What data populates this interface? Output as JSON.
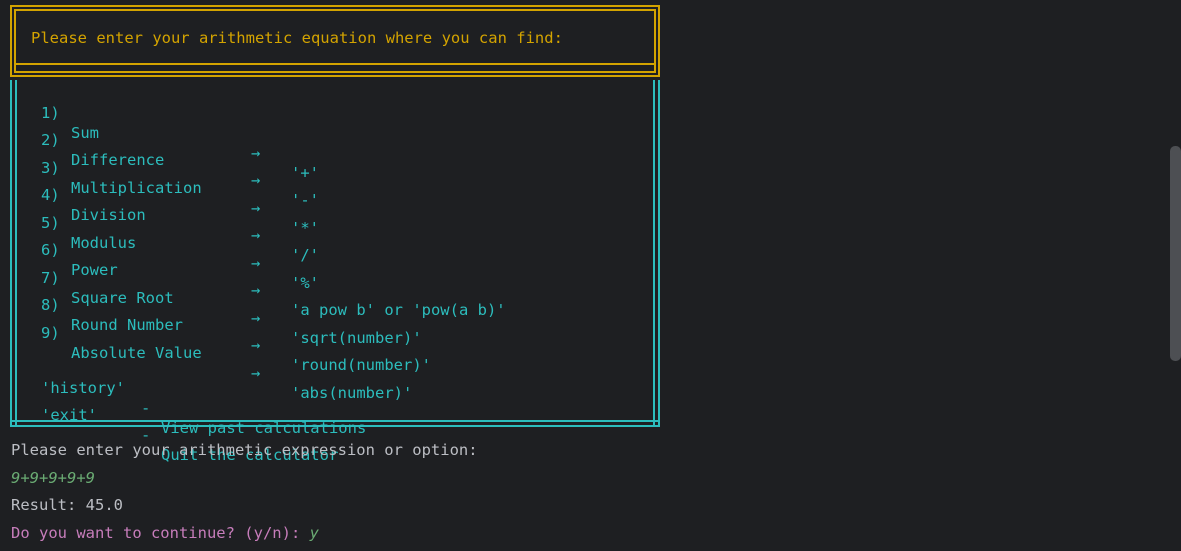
{
  "menu": {
    "header_title": "Please enter your arithmetic equation where you can find:",
    "operations": [
      {
        "num": "1)",
        "name": "Sum",
        "arrow": "→",
        "op": "'+'"
      },
      {
        "num": "2)",
        "name": "Difference",
        "arrow": "→",
        "op": "'-'"
      },
      {
        "num": "3)",
        "name": "Multiplication",
        "arrow": "→",
        "op": "'*'"
      },
      {
        "num": "4)",
        "name": "Division",
        "arrow": "→",
        "op": "'/'"
      },
      {
        "num": "5)",
        "name": "Modulus",
        "arrow": "→",
        "op": "'%'"
      },
      {
        "num": "6)",
        "name": "Power",
        "arrow": "→",
        "op": "'a pow b' or 'pow(a b)'"
      },
      {
        "num": "7)",
        "name": "Square Root",
        "arrow": "→",
        "op": "'sqrt(number)'"
      },
      {
        "num": "8)",
        "name": "Round Number",
        "arrow": "→",
        "op": "'round(number)'"
      },
      {
        "num": "9)",
        "name": "Absolute Value",
        "arrow": "→",
        "op": "'abs(number)'"
      }
    ],
    "commands": [
      {
        "key": "'history'",
        "dash": "-",
        "desc": "View past calculations"
      },
      {
        "key": "'exit'",
        "dash": "-",
        "desc": "Quit the calculator"
      }
    ]
  },
  "terminal": {
    "prompt": "Please enter your arithmetic expression or option:",
    "input": "9+9+9+9+9",
    "result": "Result: 45.0",
    "continue_prompt": "Do you want to continue? (y/n): ",
    "continue_input": "y"
  },
  "colors": {
    "background": "#1e1f22",
    "header": "#d3a300",
    "menu": "#2cbdbd",
    "input": "#6aab73",
    "continue": "#c77dbb"
  }
}
